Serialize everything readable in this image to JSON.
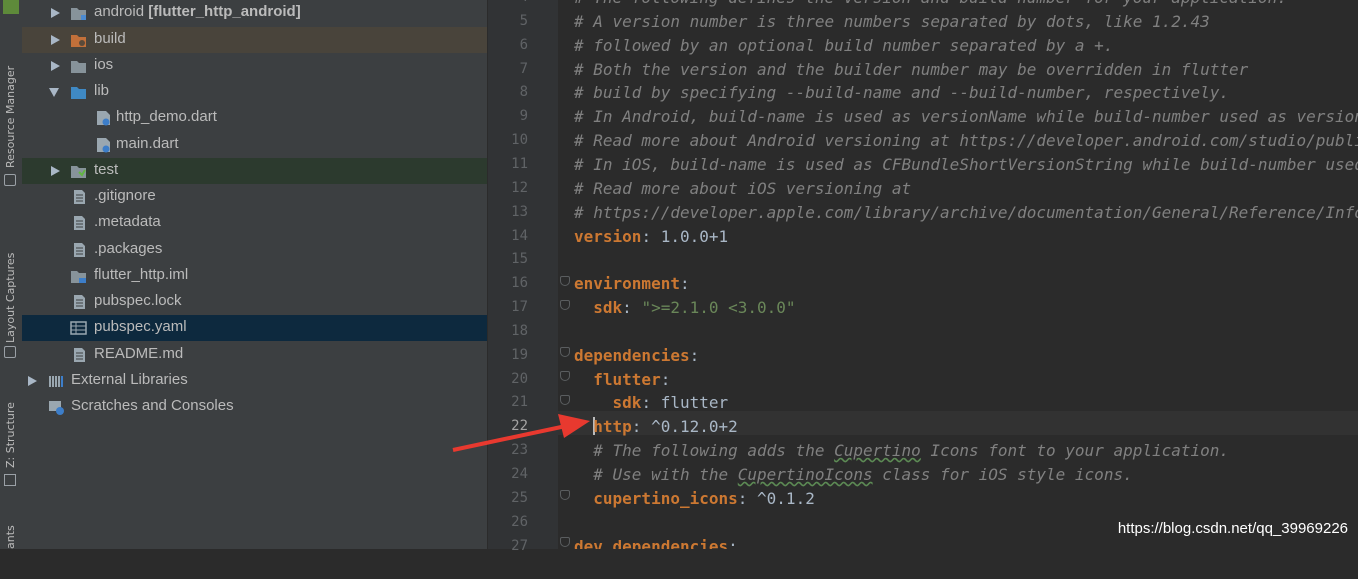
{
  "side_tabs": [
    {
      "label": "Resource Manager"
    },
    {
      "label": "Layout Captures"
    },
    {
      "label": "Z: Structure"
    },
    {
      "label": "ants"
    }
  ],
  "tree": {
    "items": [
      {
        "label": "android",
        "suffix": " [flutter_http_android]",
        "icon": "folder-module-icon"
      },
      {
        "label": "build",
        "icon": "folder-excluded-icon"
      },
      {
        "label": "ios",
        "icon": "folder-icon"
      },
      {
        "label": "lib",
        "icon": "folder-source-icon"
      },
      {
        "label": "http_demo.dart",
        "icon": "dart-file-icon"
      },
      {
        "label": "main.dart",
        "icon": "dart-file-icon"
      },
      {
        "label": "test",
        "icon": "folder-test-icon"
      },
      {
        "label": ".gitignore",
        "icon": "text-file-icon"
      },
      {
        "label": ".metadata",
        "icon": "text-file-icon"
      },
      {
        "label": ".packages",
        "icon": "text-file-icon"
      },
      {
        "label": "flutter_http.iml",
        "icon": "module-file-icon"
      },
      {
        "label": "pubspec.lock",
        "icon": "text-file-icon"
      },
      {
        "label": "pubspec.yaml",
        "icon": "yaml-file-icon"
      },
      {
        "label": "README.md",
        "icon": "text-file-icon"
      },
      {
        "label": "External Libraries",
        "icon": "library-icon"
      },
      {
        "label": "Scratches and Consoles",
        "icon": "scratches-icon"
      }
    ]
  },
  "editor": {
    "lines": [
      {
        "n": "4",
        "t": "# The following defines the version and build number for your application."
      },
      {
        "n": "5",
        "t": "# A version number is three numbers separated by dots, like 1.2.43"
      },
      {
        "n": "6",
        "t": "# followed by an optional build number separated by a +."
      },
      {
        "n": "7",
        "t": "# Both the version and the builder number may be overridden in flutter"
      },
      {
        "n": "8",
        "t": "# build by specifying --build-name and --build-number, respectively."
      },
      {
        "n": "9",
        "t": "# In Android, build-name is used as versionName while build-number used as versionCode."
      },
      {
        "n": "10",
        "t": "# Read more about Android versioning at https://developer.android.com/studio/publish/versioning"
      },
      {
        "n": "11",
        "t": "# In iOS, build-name is used as CFBundleShortVersionString while build-number used as CFBundleVersion."
      },
      {
        "n": "12",
        "t": "# Read more about iOS versioning at"
      },
      {
        "n": "13",
        "t": "# https://developer.apple.com/library/archive/documentation/General/Reference/InfoPlistKeyReference/Articles/CoreFoundationKeys.html"
      },
      {
        "n": "14",
        "k": "version",
        "v": ": 1.0.0+1"
      },
      {
        "n": "15"
      },
      {
        "n": "16",
        "k": "environment",
        "v": ":"
      },
      {
        "n": "17",
        "indent": "  ",
        "k": "sdk",
        "v": ": ",
        "s": "\">=2.1.0 <3.0.0\""
      },
      {
        "n": "18"
      },
      {
        "n": "19",
        "k": "dependencies",
        "v": ":"
      },
      {
        "n": "20",
        "indent": "  ",
        "k": "flutter",
        "v": ":"
      },
      {
        "n": "21",
        "indent": "    ",
        "k": "sdk",
        "v": ": flutter"
      },
      {
        "n": "22",
        "indent": "  ",
        "k": "http",
        "v": ": ^0.12.0+2"
      },
      {
        "n": "23",
        "indent": "  ",
        "c1": "# The following adds the ",
        "w": "Cupertino",
        "c2": " Icons font to your application."
      },
      {
        "n": "24",
        "indent": "  ",
        "c1": "# Use with the ",
        "w": "CupertinoIcons",
        "c2": " class for iOS style icons."
      },
      {
        "n": "25",
        "indent": "  ",
        "k": "cupertino_icons",
        "v": ": ^0.1.2"
      },
      {
        "n": "26"
      },
      {
        "n": "27",
        "k": "dev_dependencies",
        "v": ":"
      }
    ]
  },
  "watermark": "https://blog.csdn.net/qq_39969226",
  "colors": {
    "arrow": "#e8392f",
    "key": "#cc7832",
    "comment": "#808080",
    "string": "#6a8759"
  }
}
